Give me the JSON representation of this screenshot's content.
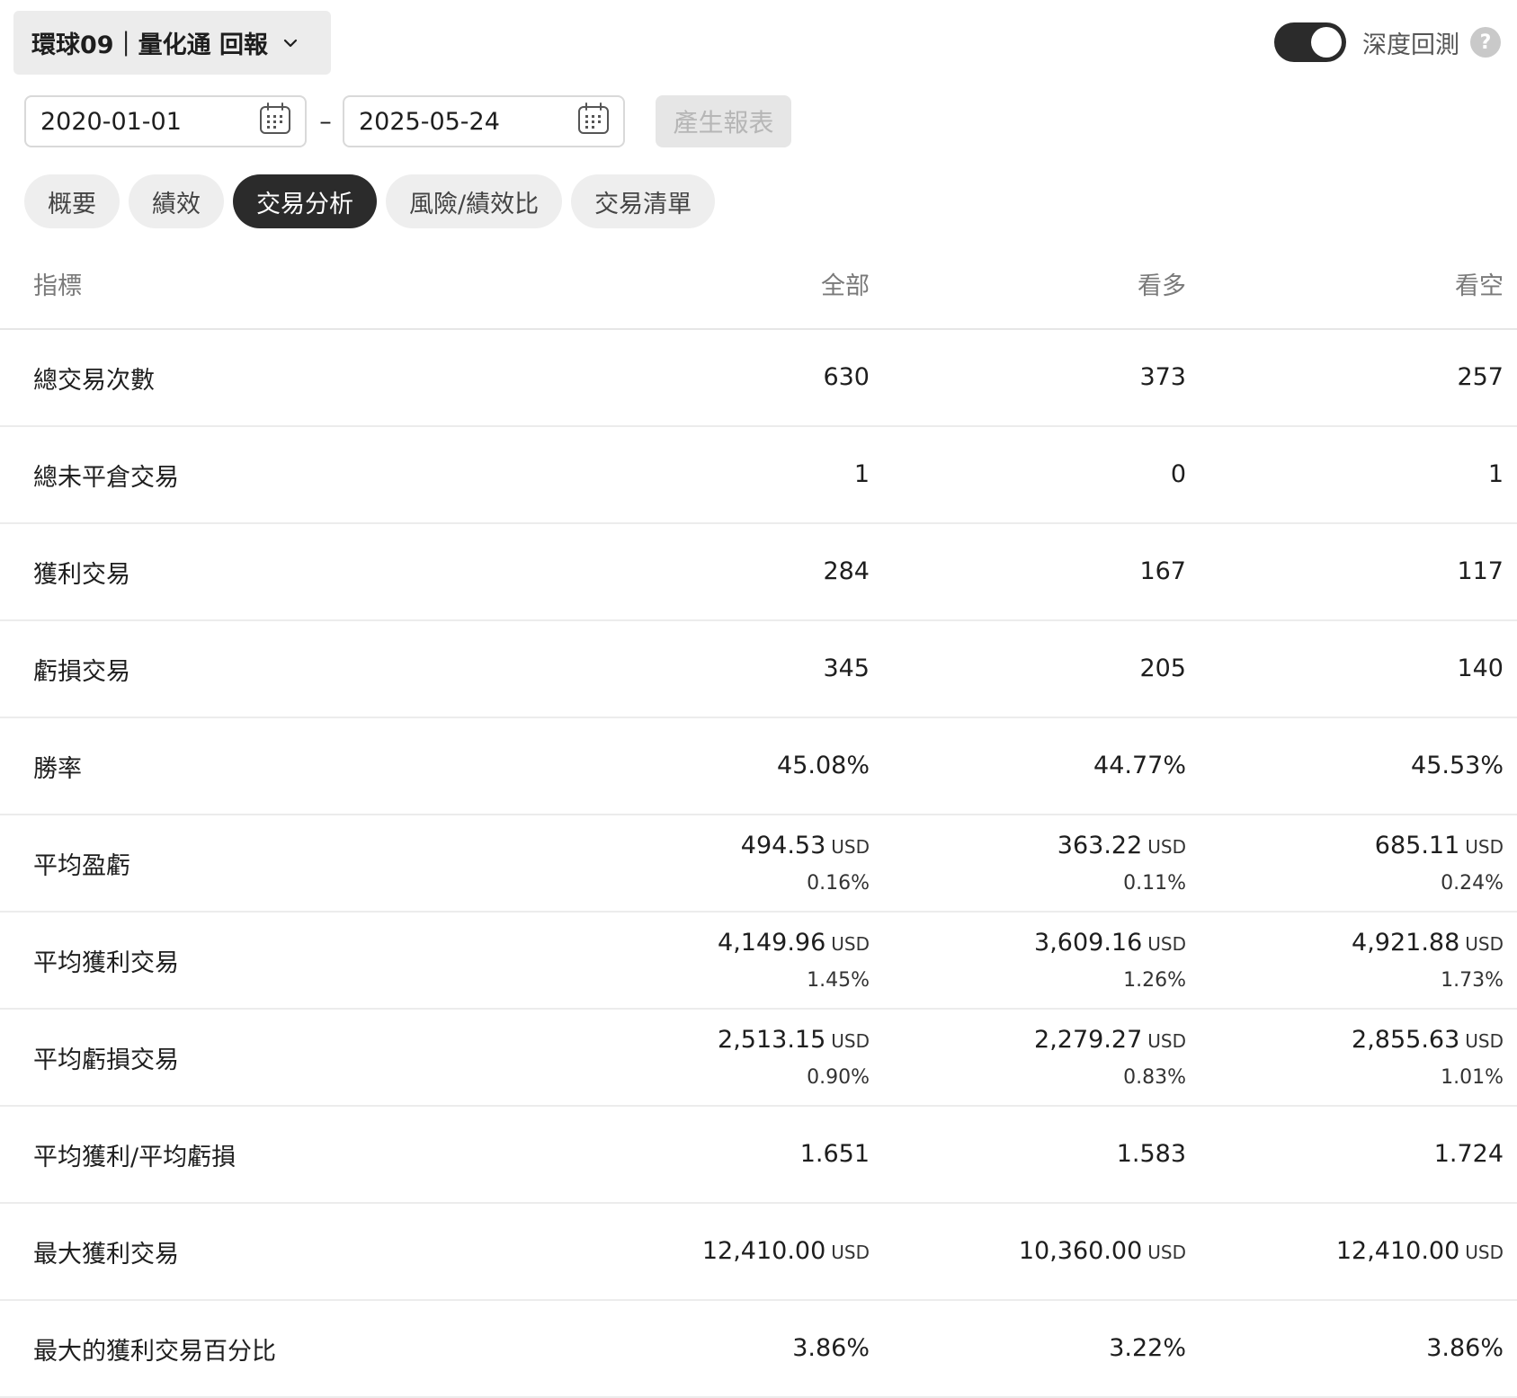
{
  "header": {
    "title": "環球09｜量化通 回報",
    "toggle_label": "深度回測",
    "help_glyph": "?"
  },
  "dates": {
    "start": "2020-01-01",
    "separator": "–",
    "end": "2025-05-24",
    "generate_label": "產生報表"
  },
  "tabs": [
    {
      "label": "概要"
    },
    {
      "label": "績效"
    },
    {
      "label": "交易分析",
      "active": true
    },
    {
      "label": "風險/績效比"
    },
    {
      "label": "交易清單"
    }
  ],
  "table": {
    "headers": {
      "metric": "指標",
      "all": "全部",
      "long": "看多",
      "short": "看空"
    },
    "rows": [
      {
        "label": "總交易次數",
        "all": {
          "value": "630"
        },
        "long": {
          "value": "373"
        },
        "short": {
          "value": "257"
        }
      },
      {
        "label": "總未平倉交易",
        "all": {
          "value": "1"
        },
        "long": {
          "value": "0"
        },
        "short": {
          "value": "1"
        }
      },
      {
        "label": "獲利交易",
        "all": {
          "value": "284"
        },
        "long": {
          "value": "167"
        },
        "short": {
          "value": "117"
        }
      },
      {
        "label": "虧損交易",
        "all": {
          "value": "345"
        },
        "long": {
          "value": "205"
        },
        "short": {
          "value": "140"
        }
      },
      {
        "label": "勝率",
        "all": {
          "value": "45.08%"
        },
        "long": {
          "value": "44.77%"
        },
        "short": {
          "value": "45.53%"
        }
      },
      {
        "label": "平均盈虧",
        "all": {
          "value": "494.53",
          "unit": "USD",
          "pct": "0.16%"
        },
        "long": {
          "value": "363.22",
          "unit": "USD",
          "pct": "0.11%"
        },
        "short": {
          "value": "685.11",
          "unit": "USD",
          "pct": "0.24%"
        }
      },
      {
        "label": "平均獲利交易",
        "all": {
          "value": "4,149.96",
          "unit": "USD",
          "pct": "1.45%"
        },
        "long": {
          "value": "3,609.16",
          "unit": "USD",
          "pct": "1.26%"
        },
        "short": {
          "value": "4,921.88",
          "unit": "USD",
          "pct": "1.73%"
        }
      },
      {
        "label": "平均虧損交易",
        "all": {
          "value": "2,513.15",
          "unit": "USD",
          "pct": "0.90%"
        },
        "long": {
          "value": "2,279.27",
          "unit": "USD",
          "pct": "0.83%"
        },
        "short": {
          "value": "2,855.63",
          "unit": "USD",
          "pct": "1.01%"
        }
      },
      {
        "label": "平均獲利/平均虧損",
        "all": {
          "value": "1.651"
        },
        "long": {
          "value": "1.583"
        },
        "short": {
          "value": "1.724"
        }
      },
      {
        "label": "最大獲利交易",
        "all": {
          "value": "12,410.00",
          "unit": "USD"
        },
        "long": {
          "value": "10,360.00",
          "unit": "USD"
        },
        "short": {
          "value": "12,410.00",
          "unit": "USD"
        }
      },
      {
        "label": "最大的獲利交易百分比",
        "all": {
          "value": "3.86%"
        },
        "long": {
          "value": "3.22%"
        },
        "short": {
          "value": "3.86%"
        }
      }
    ]
  }
}
